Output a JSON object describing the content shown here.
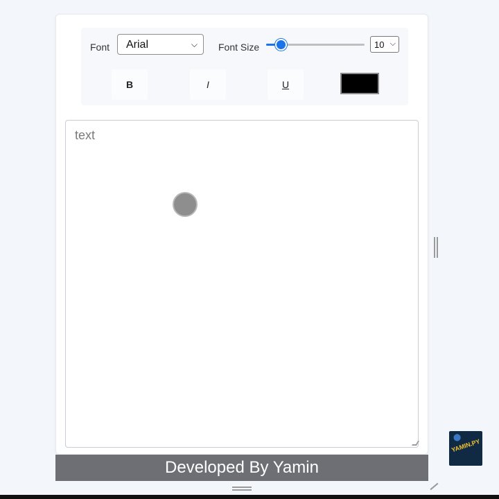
{
  "toolbar": {
    "font_label": "Font",
    "font_value": "Arial",
    "font_size_label": "Font Size",
    "font_size_slider": 0.1,
    "font_size_value": "10",
    "bold_label": "B",
    "italic_label": "I",
    "underline_label": "U",
    "color_value": "#000000"
  },
  "editor": {
    "placeholder": "text"
  },
  "footer": {
    "text": "Developed By Yamin"
  },
  "watermark": {
    "text": "YAMIN.PY"
  },
  "colors": {
    "accent": "#1a73e8",
    "footer_bg": "#6d6f74"
  }
}
